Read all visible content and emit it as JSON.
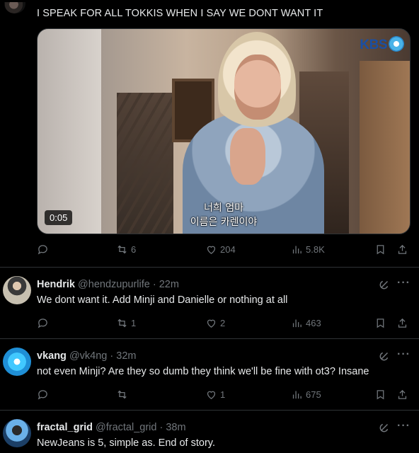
{
  "main_post": {
    "text": "I SPEAK FOR ALL TOKKIS WHEN I SAY WE DONT WANT IT",
    "video": {
      "watermark": "KBS",
      "subtitle_line1": "너희 엄마",
      "subtitle_line2": "이름은 카렌이야",
      "time": "0:05"
    },
    "actions": {
      "retweets": "6",
      "likes": "204",
      "views": "5.8K"
    }
  },
  "replies": [
    {
      "name": "Hendrik",
      "handle": "@hendzupurlife · 22m",
      "text": "We dont want it. Add Minji and Danielle or nothing at all",
      "retweets": "1",
      "likes": "2",
      "views": "463"
    },
    {
      "name": "vkang",
      "handle": "@vk4ng · 32m",
      "text": "not even Minji? Are they so dumb they think we'll be fine with ot3? Insane",
      "retweets": "",
      "likes": "1",
      "views": "675"
    },
    {
      "name": "fractal_grid",
      "handle": "@fractal_grid · 38m",
      "text": "NewJeans is 5, simple as. End of story."
    }
  ],
  "colors": {
    "background": "#000000",
    "text": "#e7e9ea",
    "muted": "#71767b",
    "divider": "#2f3336"
  }
}
